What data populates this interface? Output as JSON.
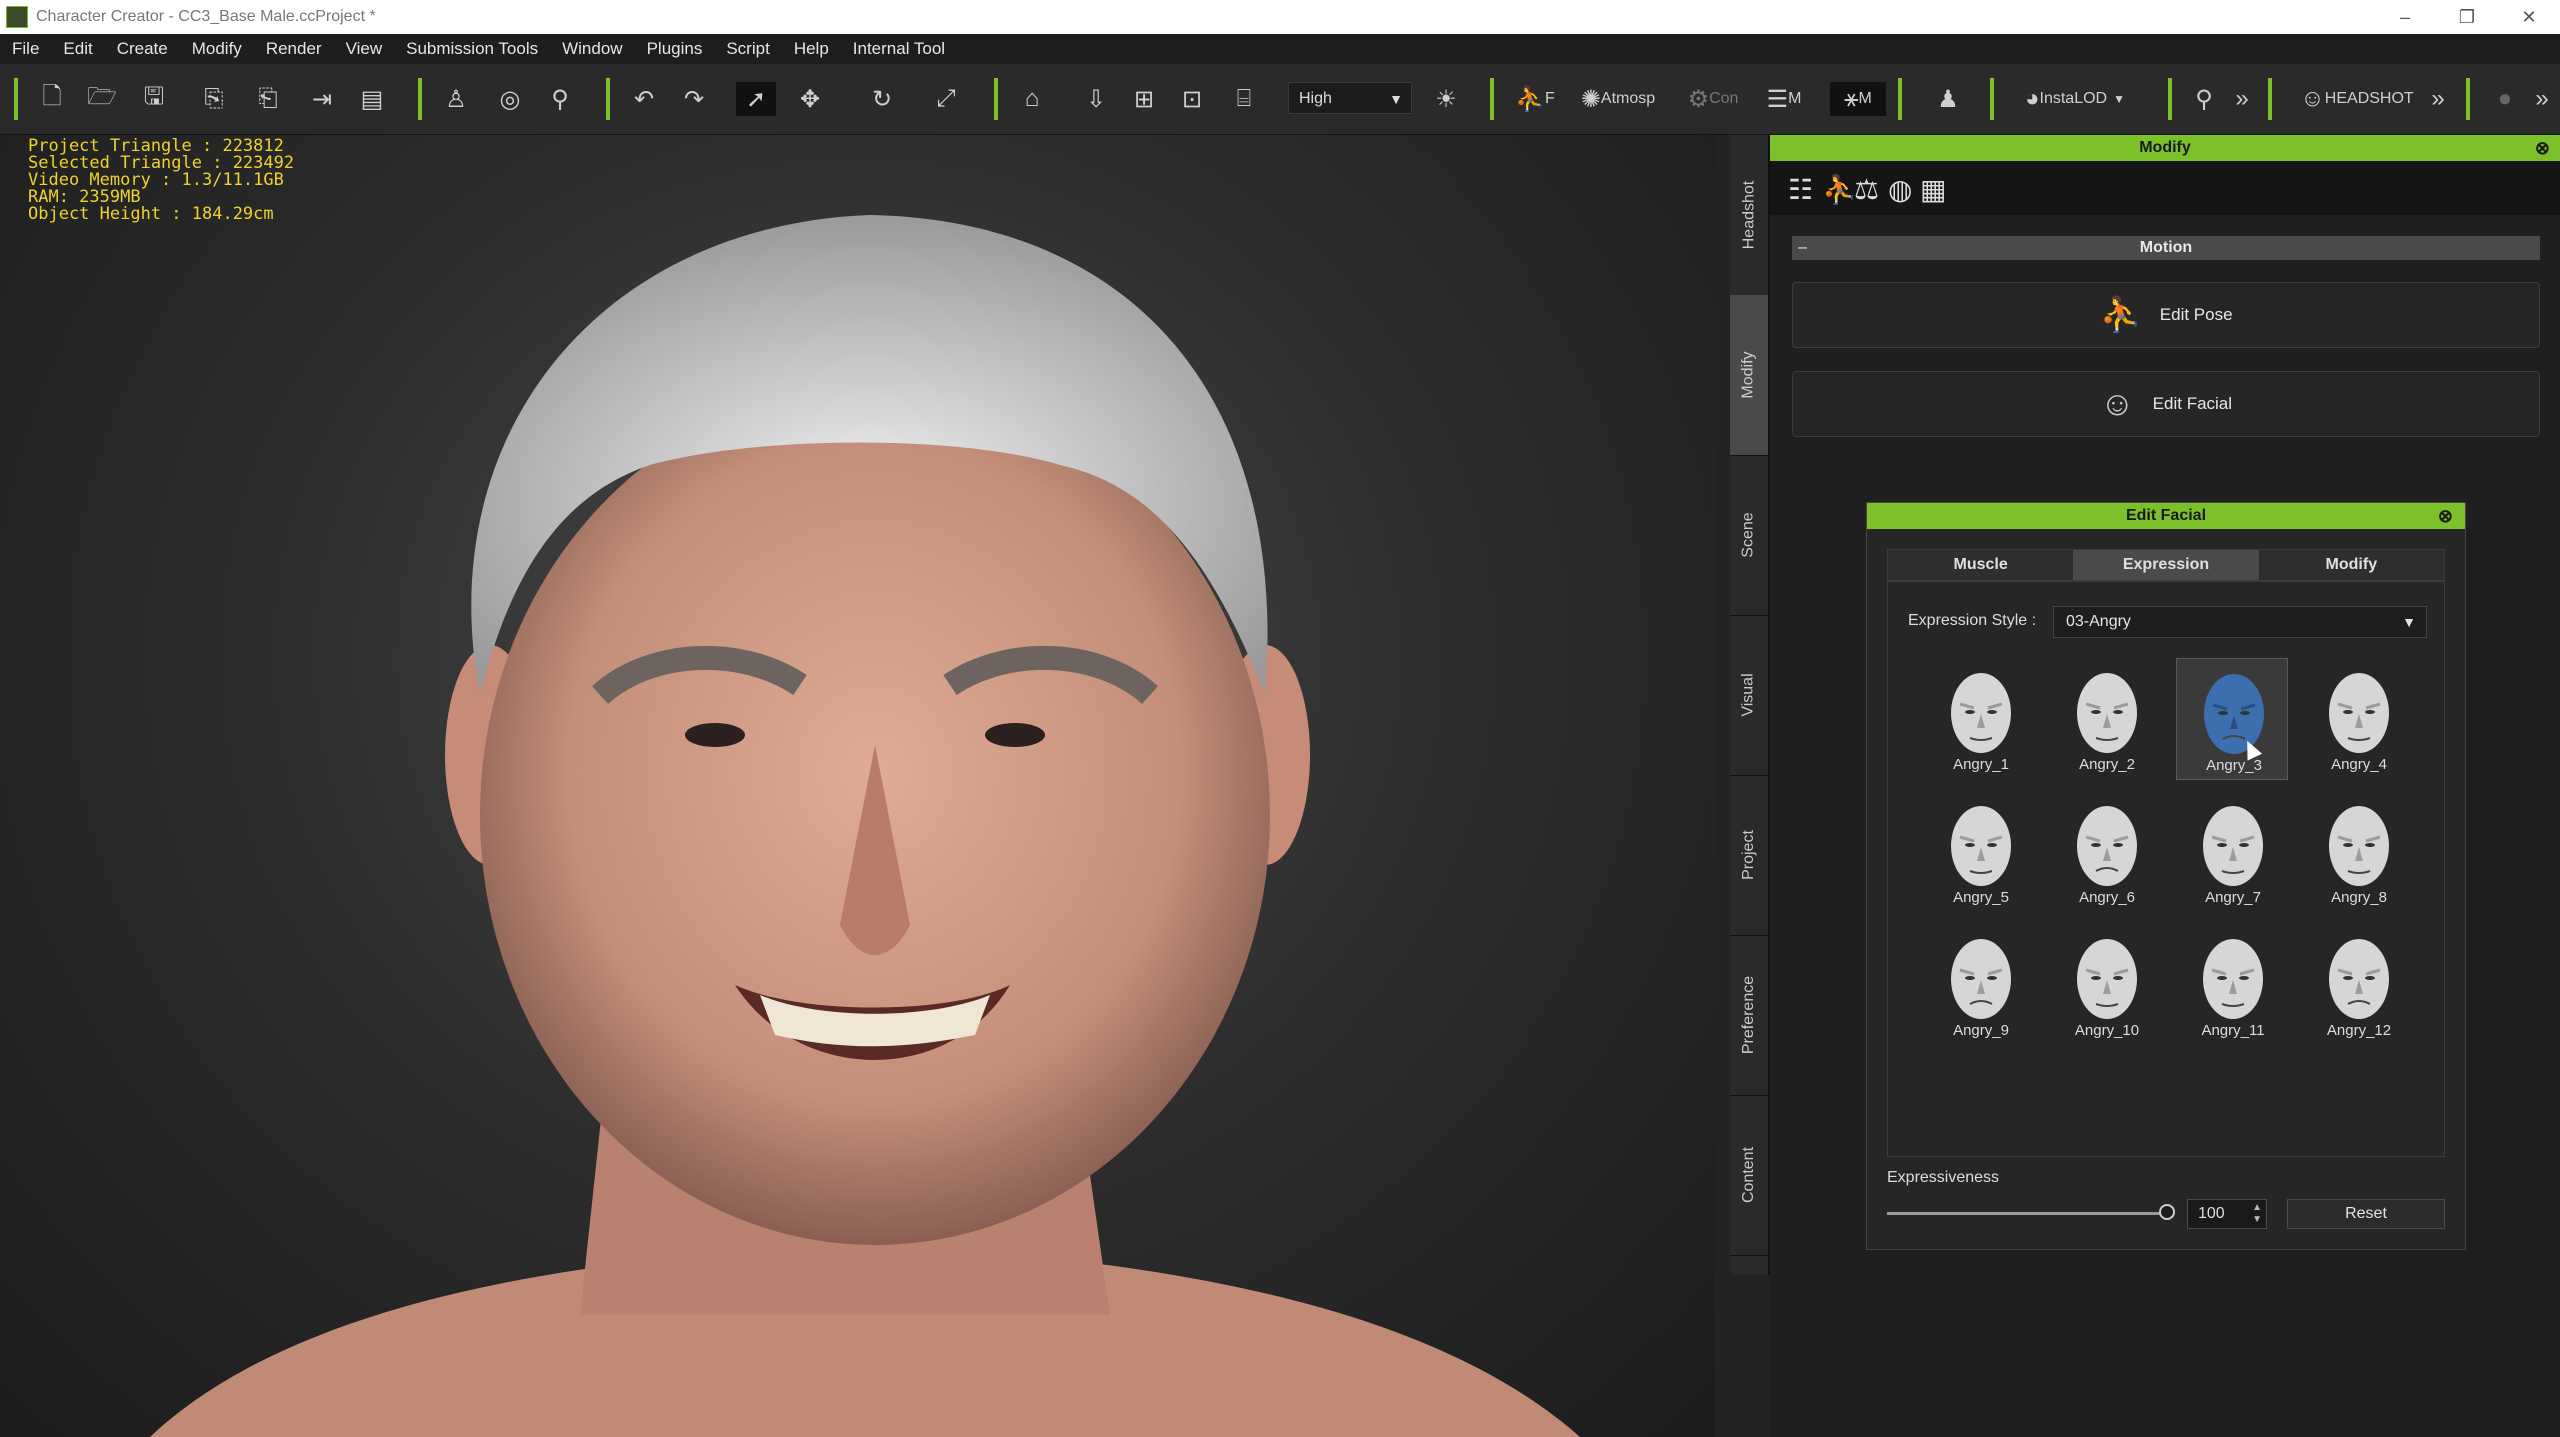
{
  "window": {
    "title": "Character Creator - CC3_Base Male.ccProject *",
    "controls": [
      "–",
      "❐",
      "✕"
    ]
  },
  "menu": [
    "File",
    "Edit",
    "Create",
    "Modify",
    "Render",
    "View",
    "Submission Tools",
    "Window",
    "Plugins",
    "Script",
    "Help",
    "Internal Tool"
  ],
  "toolbar": {
    "quality": "High",
    "atmosphere_label": "Atmosp",
    "con_label": "Con",
    "m_label": "M",
    "m2_label": "M",
    "instalod_label": "InstaLOD",
    "headshot_label": "HEADSHOT",
    "f_label": "F"
  },
  "stats": {
    "project_triangle": "Project Triangle : 223812",
    "selected_triangle": "Selected Triangle : 223492",
    "video_memory": "Video Memory : 1.3/11.1GB",
    "ram": "RAM: 2359MB",
    "object_height": "Object Height : 184.29cm"
  },
  "side_tabs": [
    "Headshot",
    "Modify",
    "Scene",
    "Visual",
    "Project",
    "Preference",
    "Content"
  ],
  "active_side_tab": "Modify",
  "panel": {
    "title": "Modify",
    "section": "Motion",
    "edit_pose": "Edit Pose",
    "edit_facial": "Edit Facial"
  },
  "dialog": {
    "title": "Edit Facial",
    "tabs": [
      "Muscle",
      "Expression",
      "Modify"
    ],
    "active_tab": "Expression",
    "expression_style_label": "Expression Style :",
    "expression_style_value": "03-Angry",
    "expressions": [
      "Angry_1",
      "Angry_2",
      "Angry_3",
      "Angry_4",
      "Angry_5",
      "Angry_6",
      "Angry_7",
      "Angry_8",
      "Angry_9",
      "Angry_10",
      "Angry_11",
      "Angry_12"
    ],
    "selected_expression": "Angry_3",
    "expressiveness_label": "Expressiveness",
    "expressiveness_value": "100",
    "expressiveness_fraction": 1.0,
    "reset_label": "Reset"
  },
  "colors": {
    "accent": "#7cc02a",
    "stats_text": "#f0d22a"
  }
}
